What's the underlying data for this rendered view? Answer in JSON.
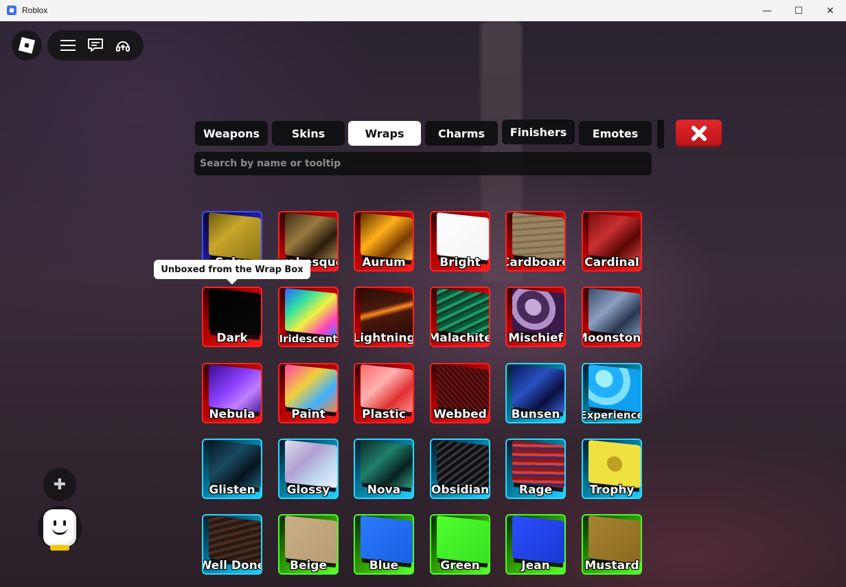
{
  "window": {
    "title": "Roblox",
    "minimize": "—",
    "maximize": "☐",
    "close": "✕"
  },
  "tabs": [
    {
      "label": "Weapons",
      "active": false
    },
    {
      "label": "Skins",
      "active": false
    },
    {
      "label": "Wraps",
      "active": true
    },
    {
      "label": "Charms",
      "active": false
    },
    {
      "label": "Finishers",
      "active": false
    },
    {
      "label": "Emotes",
      "active": false
    }
  ],
  "search": {
    "placeholder": "Search by name or tooltip",
    "value": ""
  },
  "tooltip": {
    "text": "Unboxed from the Wrap Box"
  },
  "items": [
    {
      "label": "Solar",
      "rarity": "blue",
      "swatch": "linear-gradient(135deg,#6b5a10,#c8a52a 40%,#8a7416)"
    },
    {
      "label": "Arabesque",
      "rarity": "red",
      "swatch": "linear-gradient(135deg,#3a2a12,#9a7a40 40%,#2a1c0a 70%,#a88450)"
    },
    {
      "label": "Aurum",
      "rarity": "red",
      "swatch": "linear-gradient(135deg,#5a2a00,#ffb01a 40%,#7a3a00 70%,#ffc040)"
    },
    {
      "label": "Bright",
      "rarity": "red",
      "swatch": "linear-gradient(135deg,#ffffff,#f4f4f4)"
    },
    {
      "label": "Cardboard",
      "rarity": "red",
      "swatch": "repeating-linear-gradient(170deg,#9a8462 0 6px,#7e6a4c 6px 9px)"
    },
    {
      "label": "Cardinal",
      "rarity": "red",
      "swatch": "linear-gradient(135deg,#7a0a0a,#c83030 40%,#5a0606 70%,#d04040)"
    },
    {
      "label": "Dark",
      "rarity": "red",
      "swatch": "linear-gradient(135deg,#000000,#080808)"
    },
    {
      "label": "Iridescent",
      "rarity": "red",
      "swatch": "linear-gradient(135deg,#2a60ff,#30e0a0 30%,#f0f040 55%,#ff40c0 80%,#4080ff)"
    },
    {
      "label": "Lightning",
      "rarity": "red",
      "swatch": "linear-gradient(160deg,#2a0a06 0%,#4a1a0c 40%,#ff8a20 48%,#4a1a0c 56%,#2a0a06)"
    },
    {
      "label": "Malachite",
      "rarity": "red",
      "swatch": "repeating-linear-gradient(150deg,#0a5a3a 0 5px,#1a9a6a 5px 9px,#0a3a24 9px 12px)"
    },
    {
      "label": "Mischief",
      "rarity": "red",
      "swatch": "radial-gradient(circle at 40% 40%,#c8a8d8 0 20%,#4a2a5a 21% 40%,#b090c8 41% 55%,#3a1a4a 56%)"
    },
    {
      "label": "Moonstone",
      "rarity": "red",
      "swatch": "linear-gradient(135deg,#3a4a6a,#8aa0c0 40%,#2a3650 70%,#7a90b0)"
    },
    {
      "label": "Nebula",
      "rarity": "red",
      "swatch": "linear-gradient(135deg,#3a0a8a,#8a40ff 45%,#c080ff 70%,#4a20a0)"
    },
    {
      "label": "Paint",
      "rarity": "red",
      "swatch": "linear-gradient(135deg,#ff40a0,#f0d040 40%,#40b0ff 70%,#ff8040)"
    },
    {
      "label": "Plastic",
      "rarity": "red",
      "swatch": "linear-gradient(135deg,#ff6a6a,#ffb0b0 40%,#e03030 70%,#ff8a8a)"
    },
    {
      "label": "Webbed",
      "rarity": "red",
      "swatch": "repeating-linear-gradient(45deg,#3a0808 0 3px,#6a1414 3px 6px)"
    },
    {
      "label": "Bunsen",
      "rarity": "cyan",
      "swatch": "linear-gradient(135deg,#0a1a5a,#2a50c0 40%,#081040 70%,#3a60d0)"
    },
    {
      "label": "Experience",
      "rarity": "cyan",
      "swatch": "radial-gradient(circle at 30% 30%,#a0f0ff 0 18%,#20b0ff 19% 40%,#80e0ff 41% 55%,#10a0f0 56%)"
    },
    {
      "label": "Glisten",
      "rarity": "cyan",
      "swatch": "linear-gradient(135deg,#06141e,#1a4a60 40%,#06141e 70%,#20607a)"
    },
    {
      "label": "Glossy",
      "rarity": "cyan",
      "swatch": "linear-gradient(135deg,#e0e0f0,#b0a0d0 40%,#c0d8f0 70%,#f0f0ff)"
    },
    {
      "label": "Nova",
      "rarity": "cyan",
      "swatch": "linear-gradient(135deg,#0a2a2a,#20806a 40%,#082020 70%,#30a080)"
    },
    {
      "label": "Obsidian",
      "rarity": "cyan",
      "swatch": "repeating-linear-gradient(140deg,#101012 0 5px,#3a3a40 5px 8px)"
    },
    {
      "label": "Rage",
      "rarity": "cyan",
      "swatch": "repeating-linear-gradient(175deg,#8a1a1a 0 6px,#d04040 6px 10px,#3a2a6a 10px 13px)"
    },
    {
      "label": "Trophy",
      "rarity": "cyan",
      "swatch": "radial-gradient(circle at 50% 50%,#c0a020 0 22%,#f0e040 23%)"
    },
    {
      "label": "Well Done",
      "rarity": "cyan",
      "swatch": "repeating-linear-gradient(160deg,#2a1812 0 5px,#4a2c20 5px 9px)"
    },
    {
      "label": "Beige",
      "rarity": "green",
      "swatch": "linear-gradient(135deg,#c8ae86,#b89c74)"
    },
    {
      "label": "Blue",
      "rarity": "green",
      "swatch": "linear-gradient(135deg,#2a7aff,#1a60e0)"
    },
    {
      "label": "Green",
      "rarity": "green",
      "swatch": "linear-gradient(135deg,#50ff30,#36e020)"
    },
    {
      "label": "Jean",
      "rarity": "green",
      "swatch": "linear-gradient(135deg,#2a50ff,#1a38d0)"
    },
    {
      "label": "Mustard",
      "rarity": "green",
      "swatch": "linear-gradient(135deg,#a88430,#8a6a22)"
    }
  ],
  "icons": {
    "home": "roblox-logo-icon",
    "menu": "hamburger-menu-icon",
    "chat": "chat-icon",
    "voice": "headset-icon",
    "emote": "plus-icon",
    "avatar": "avatar-icon",
    "close": "x-icon"
  },
  "emote_glyph": "✚",
  "colors": {
    "rarity_red": "#ff2222",
    "rarity_blue": "#4a4cff",
    "rarity_cyan": "#33d6ff",
    "rarity_green": "#4cff2a",
    "close_button": "#e3262a"
  }
}
